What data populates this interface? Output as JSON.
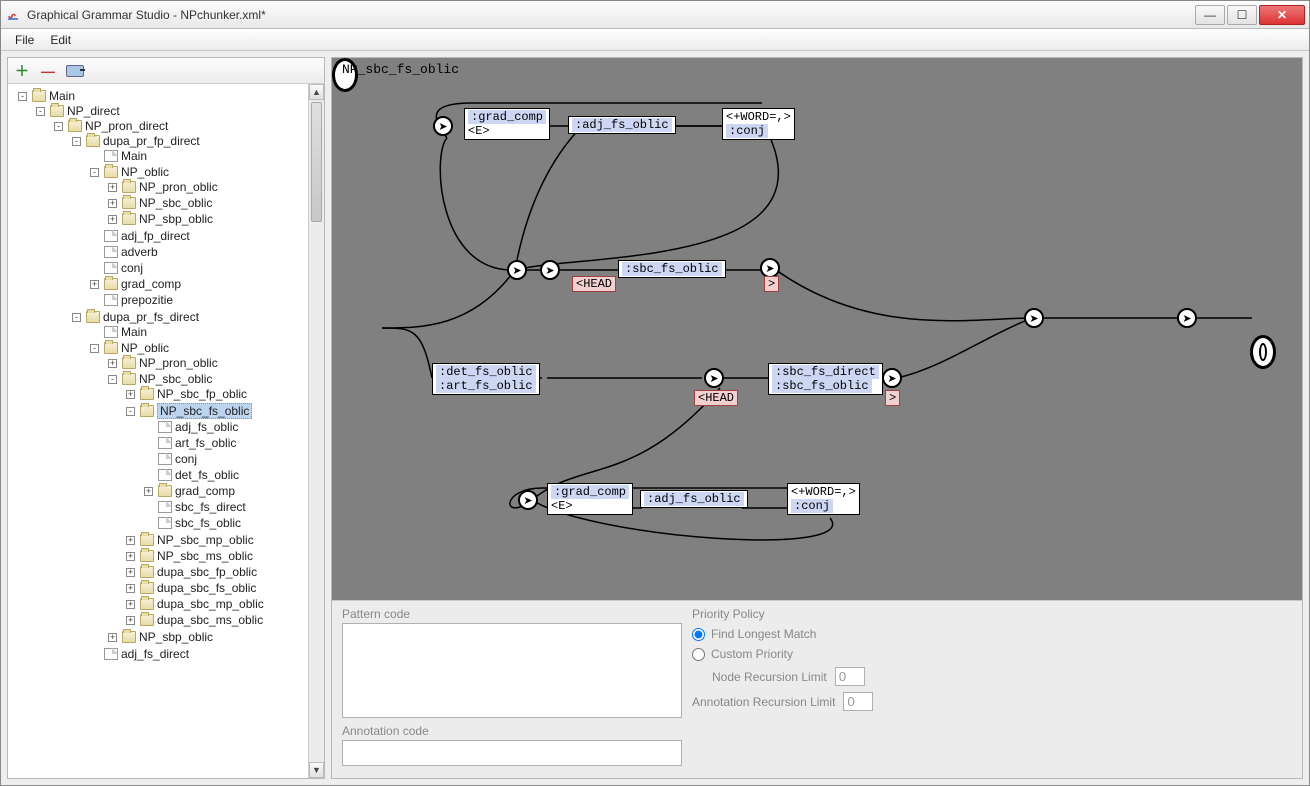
{
  "window": {
    "title": "Graphical Grammar Studio - NPchunker.xml*"
  },
  "menu": {
    "file": "File",
    "edit": "Edit"
  },
  "winbuttons": {
    "min": "—",
    "max": "☐",
    "close": "✕"
  },
  "canvas": {
    "title": "NP_sbc_fs_oblic",
    "box_grad_top": ":grad_comp",
    "box_grad_top_sub": "<E>",
    "box_adj_top": ":adj_fs_oblic",
    "box_word_top": "<+WORD=,>",
    "box_word_top_sub": ":conj",
    "box_sbc_mid": ":sbc_fs_oblic",
    "pink_head1": "<HEAD",
    "pink_gt1": ">",
    "box_det": ":det_fs_oblic",
    "box_det_sub": ":art_fs_oblic",
    "pink_head2": "<HEAD",
    "box_sbc_dir": ":sbc_fs_direct",
    "box_sbc_dir_sub": ":sbc_fs_oblic",
    "pink_gt2": ">",
    "box_grad_bot": ":grad_comp",
    "box_grad_bot_sub": "<E>",
    "box_adj_bot": ":adj_fs_oblic",
    "box_word_bot": "<+WORD=,>",
    "box_word_bot_sub": ":conj"
  },
  "tree": {
    "main": "Main",
    "np_direct": "NP_direct",
    "np_pron_direct": "NP_pron_direct",
    "dupa_pr_fp_direct": "dupa_pr_fp_direct",
    "main2": "Main",
    "np_oblic": "NP_oblic",
    "np_pron_oblic": "NP_pron_oblic",
    "np_sbc_oblic": "NP_sbc_oblic",
    "np_sbp_oblic": "NP_sbp_oblic",
    "adj_fp_direct": "adj_fp_direct",
    "adverb": "adverb",
    "conj": "conj",
    "grad_comp": "grad_comp",
    "prepozitie": "prepozitie",
    "dupa_pr_fs_direct": "dupa_pr_fs_direct",
    "main3": "Main",
    "np_oblic2": "NP_oblic",
    "np_pron_oblic2": "NP_pron_oblic",
    "np_sbc_oblic2": "NP_sbc_oblic",
    "np_sbc_fp_oblic": "NP_sbc_fp_oblic",
    "np_sbc_fs_oblic": "NP_sbc_fs_oblic",
    "adj_fs_oblic": "adj_fs_oblic",
    "art_fs_oblic": "art_fs_oblic",
    "conj2": "conj",
    "det_fs_oblic": "det_fs_oblic",
    "grad_comp2": "grad_comp",
    "sbc_fs_direct": "sbc_fs_direct",
    "sbc_fs_oblic": "sbc_fs_oblic",
    "np_sbc_mp_oblic": "NP_sbc_mp_oblic",
    "np_sbc_ms_oblic": "NP_sbc_ms_oblic",
    "dupa_sbc_fp_oblic": "dupa_sbc_fp_oblic",
    "dupa_sbc_fs_oblic": "dupa_sbc_fs_oblic",
    "dupa_sbc_mp_oblic": "dupa_sbc_mp_oblic",
    "dupa_sbc_ms_oblic": "dupa_sbc_ms_oblic",
    "np_sbp_oblic2": "NP_sbp_oblic",
    "adj_fs_direct": "adj_fs_direct"
  },
  "bottom": {
    "pattern_label": "Pattern code",
    "annotation_label": "Annotation code",
    "priority_label": "Priority Policy",
    "longest": "Find Longest Match",
    "custom": "Custom Priority",
    "node_limit_label": "Node Recursion Limit",
    "ann_limit_label": "Annotation Recursion Limit",
    "node_limit_val": "0",
    "ann_limit_val": "0"
  }
}
